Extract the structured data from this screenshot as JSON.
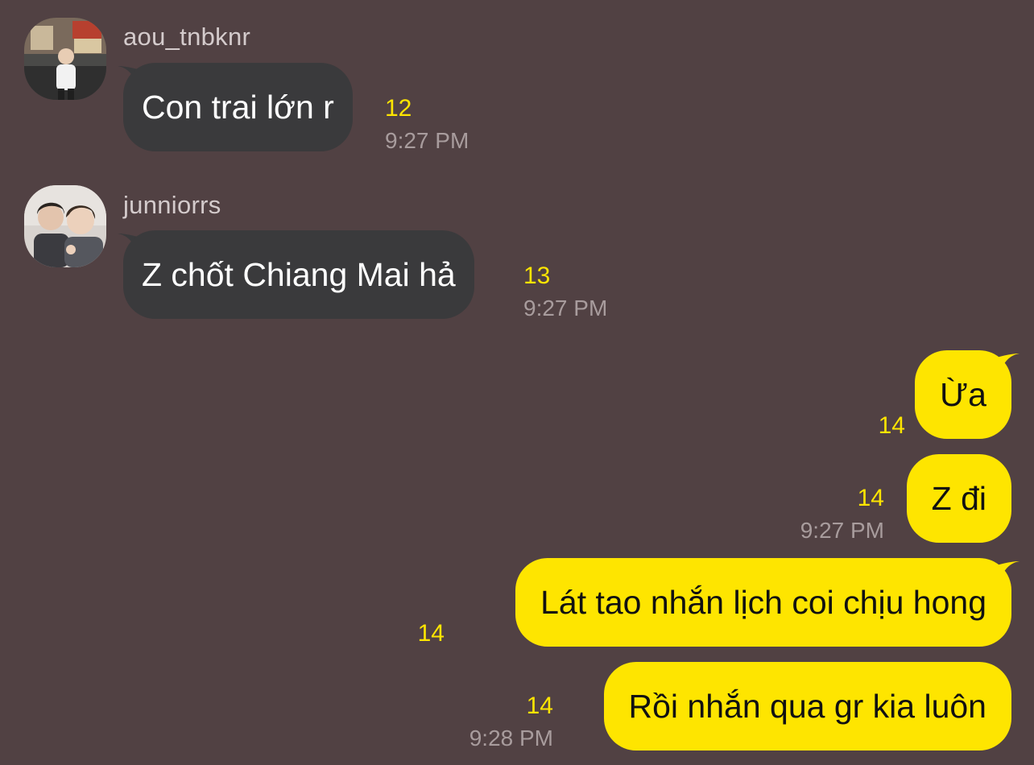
{
  "chat": {
    "messages": [
      {
        "sender": "aou_tnbknr",
        "text": "Con trai lớn r",
        "unread": "12",
        "time": "9:27 PM",
        "outgoing": false,
        "avatar": "avatar-aou"
      },
      {
        "sender": "junniorrs",
        "text": "Z chốt Chiang Mai hả",
        "unread": "13",
        "time": "9:27 PM",
        "outgoing": false,
        "avatar": "avatar-junniorrs"
      },
      {
        "text": "Ừa",
        "unread": "14",
        "outgoing": true
      },
      {
        "text": "Z đi",
        "unread": "14",
        "time": "9:27 PM",
        "outgoing": true
      },
      {
        "text": "Lát tao nhắn lịch coi chịu hong",
        "unread": "14",
        "outgoing": true
      },
      {
        "text": "Rồi nhắn qua gr kia luôn",
        "unread": "14",
        "time": "9:28 PM",
        "outgoing": true
      }
    ]
  },
  "colors": {
    "background": "#514143",
    "incoming_bubble": "#3a3a3c",
    "outgoing_bubble": "#fee500",
    "unread_count": "#fee500",
    "timestamp": "#a89c9d"
  }
}
